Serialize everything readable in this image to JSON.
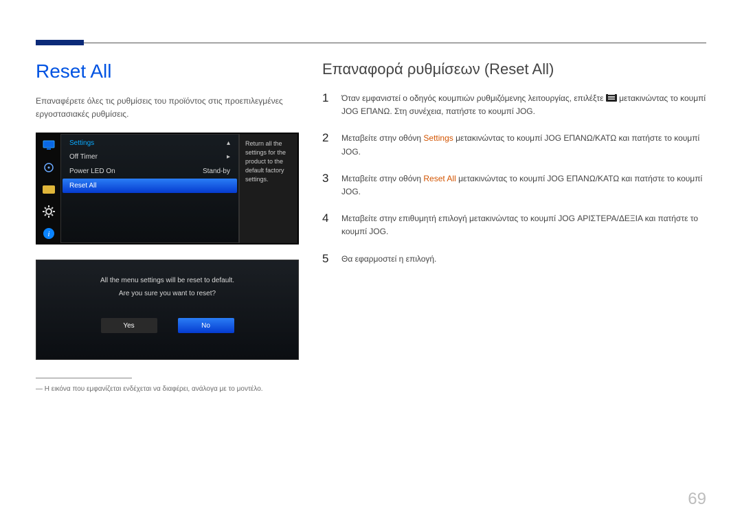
{
  "title": "Reset All",
  "intro": "Επαναφέρετε όλες τις ρυθμίσεις του προϊόντος στις προεπιλεγμένες εργοστασιακές ρυθμίσεις.",
  "osd1": {
    "header": "Settings",
    "rows": [
      {
        "label": "Off Timer",
        "value": "",
        "arrow": "▸"
      },
      {
        "label": "Power LED On",
        "value": "Stand-by",
        "arrow": ""
      },
      {
        "label": "Reset All",
        "value": "",
        "arrow": "",
        "selected": true
      }
    ],
    "desc": "Return all the settings for the product to the default factory settings."
  },
  "osd2": {
    "line1": "All the menu settings will be reset to default.",
    "line2": "Are you sure you want to reset?",
    "yes": "Yes",
    "no": "No"
  },
  "footnote": "Η εικόνα που εμφανίζεται ενδέχεται να διαφέρει, ανάλογα με το μοντέλο.",
  "right_title": "Επαναφορά ρυθμίσεων (Reset All)",
  "steps": {
    "s1a": "Όταν εμφανιστεί ο οδηγός κουμπιών ρυθμιζόμενης λειτουργίας, επιλέξτε ",
    "s1b": " μετακινώντας το κουμπί JOG ΕΠΑΝΩ. Στη συνέχεια, πατήστε το κουμπί JOG.",
    "s2a": "Μεταβείτε στην οθόνη ",
    "s2_hl": "Settings",
    "s2b": " μετακινώντας το κουμπί JOG ΕΠΑΝΩ/ΚΑΤΩ και πατήστε το κουμπί JOG.",
    "s3a": "Μεταβείτε στην οθόνη ",
    "s3_hl": "Reset All",
    "s3b": " μετακινώντας το κουμπί JOG ΕΠΑΝΩ/ΚΑΤΩ και πατήστε το κουμπί JOG.",
    "s4": "Μεταβείτε στην επιθυμητή επιλογή μετακινώντας το κουμπί JOG ΑΡΙΣΤΕΡΑ/ΔΕΞΙΑ και πατήστε το κουμπί JOG.",
    "s5": "Θα εφαρμοστεί η επιλογή."
  },
  "page_number": "69"
}
